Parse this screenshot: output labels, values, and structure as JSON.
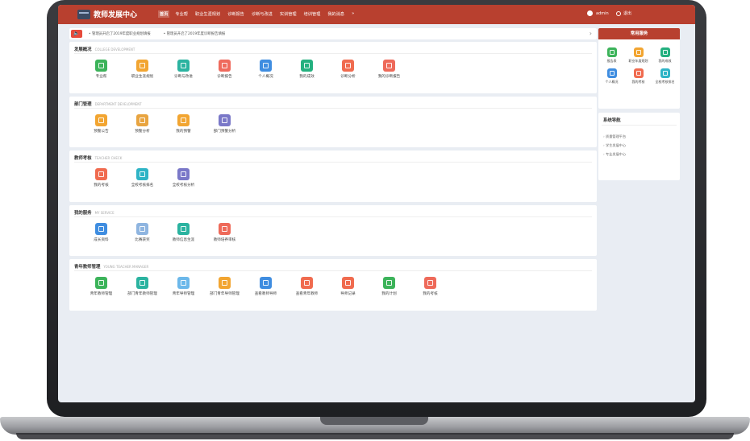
{
  "header": {
    "logo": "教师发展中心",
    "nav": [
      "首页",
      "专业帮",
      "职业生涯规划",
      "诊断报告",
      "诊断与改进",
      "实训管理",
      "培训管理",
      "我的消息",
      "»"
    ],
    "active_index": 0,
    "user": "admin",
    "logout": "退出"
  },
  "notice": {
    "icon": "🔈",
    "items": [
      "• 管理员开启了2019年度职业规划填报",
      "• 管理员开启了2019年度诊断报告填报"
    ],
    "arrow": "›"
  },
  "sections": [
    {
      "title": "发展概况",
      "subtitle": "COLLEGE DEVELOPMENT",
      "items": [
        {
          "label": "专业帮",
          "color": "#3cb35a"
        },
        {
          "label": "职业生涯规划",
          "color": "#f2a531"
        },
        {
          "label": "诊断与改进",
          "color": "#2bb3a0"
        },
        {
          "label": "诊断报告",
          "color": "#ef6a5d"
        },
        {
          "label": "个人概况",
          "color": "#3f8de0"
        },
        {
          "label": "我的成效",
          "color": "#24b07f"
        },
        {
          "label": "诊断分析",
          "color": "#f06b4f"
        },
        {
          "label": "我的诊断报告",
          "color": "#ee6a5a"
        }
      ]
    },
    {
      "title": "部门管理",
      "subtitle": "DEPARTMENT DEVELOPMENT",
      "items": [
        {
          "label": "预警公告",
          "color": "#f2a531"
        },
        {
          "label": "预警分析",
          "color": "#e8a440"
        },
        {
          "label": "我的预警",
          "color": "#f2a531"
        },
        {
          "label": "部门预警分析",
          "color": "#7a78c8"
        }
      ]
    },
    {
      "title": "教师考核",
      "subtitle": "TEACHER CHECK",
      "items": [
        {
          "label": "我的考核",
          "color": "#f06b4f"
        },
        {
          "label": "全校考核排名",
          "color": "#2fb4c6"
        },
        {
          "label": "全校考核分析",
          "color": "#7a78c8"
        }
      ]
    },
    {
      "title": "我的服务",
      "subtitle": "MY SERVICE",
      "items": [
        {
          "label": "成长资料",
          "color": "#3f8de0"
        },
        {
          "label": "比赛获奖",
          "color": "#8fb5e0"
        },
        {
          "label": "教师信息生涯",
          "color": "#2bb3a0"
        },
        {
          "label": "教师培养审核",
          "color": "#ee6a5a"
        }
      ]
    },
    {
      "title": "青年教师管理",
      "subtitle": "YOUNG TEACHER MANAGER",
      "items": [
        {
          "label": "青年教师管理",
          "color": "#3cb35a"
        },
        {
          "label": "部门青年教师管理",
          "color": "#2bb3a0"
        },
        {
          "label": "青年导师管理",
          "color": "#6cb8ea"
        },
        {
          "label": "部门青年导师管理",
          "color": "#f2a531"
        },
        {
          "label": "查看教师导师",
          "color": "#3f8de0"
        },
        {
          "label": "查看青年教师",
          "color": "#f06b4f"
        },
        {
          "label": "导师记录",
          "color": "#f06b4f"
        },
        {
          "label": "我的计划",
          "color": "#3cb35a"
        },
        {
          "label": "我的考核",
          "color": "#ee6a5a"
        }
      ]
    }
  ],
  "common_services": {
    "title": "常用服务",
    "items": [
      {
        "label": "报告表",
        "color": "#3cb35a"
      },
      {
        "label": "职业年度规划",
        "color": "#f2a531"
      },
      {
        "label": "我的成效",
        "color": "#24b07f"
      },
      {
        "label": "个人概况",
        "color": "#3f8de0"
      },
      {
        "label": "我的考核",
        "color": "#f06b4f"
      },
      {
        "label": "全校考核排名",
        "color": "#2fb4c6"
      }
    ]
  },
  "calendar": {
    "title": "系统导航",
    "items": [
      "质量管理平台",
      "学生发展中心",
      "专业发展中心"
    ]
  }
}
